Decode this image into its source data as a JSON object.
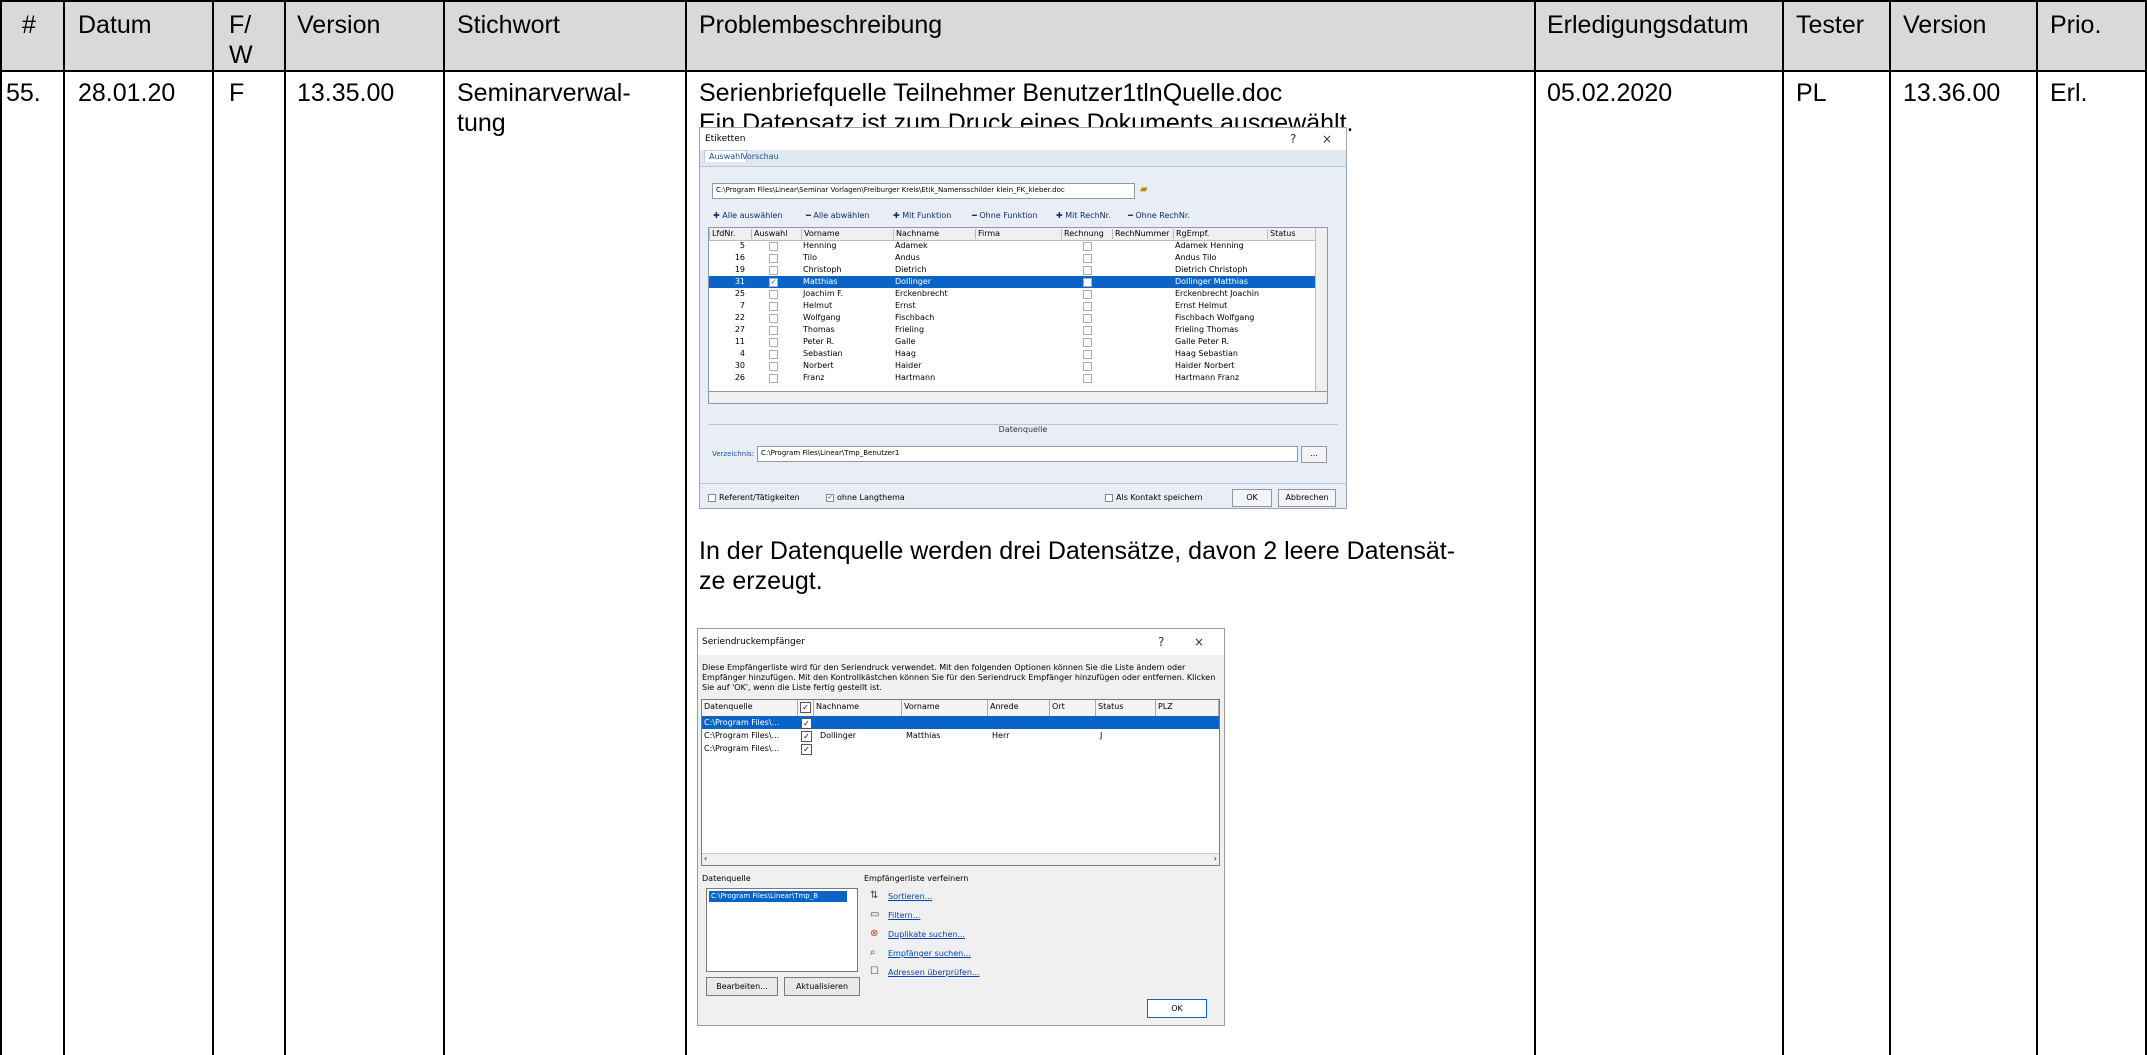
{
  "table": {
    "headers": [
      "#",
      "Datum",
      "F/\nW",
      "Version",
      "Stichwort",
      "Problembeschreibung",
      "Erledigungsdatum",
      "Tester",
      "Version",
      "Prio."
    ],
    "row": {
      "nr": "55.",
      "datum": "28.01.20",
      "fw": "F",
      "version": "13.35.00",
      "stichwort": "Seminarverwal-\ntung",
      "beschreibung_1": "Serienbriefquelle Teilnehmer Benutzer1tlnQuelle.doc\nEin Datensatz ist zum Druck eines Dokuments ausgewählt.",
      "beschreibung_2": "In der Datenquelle werden drei Datensätze, davon 2 leere Datensät-\nze erzeugt.",
      "erledigungsdatum": "05.02.2020",
      "tester": "PL",
      "version2": "13.36.00",
      "prio": "Erl."
    }
  },
  "dialog1": {
    "title": "Etiketten",
    "help": "?",
    "close": "×",
    "tabs": [
      "Auswahl",
      "Vorschau"
    ],
    "path": "C:\\Program Files\\Linear\\Seminar Vorlagen\\Freiburger Kreis\\Etik_Namensschilder klein_FK_kleber.doc",
    "actions": [
      "✚ Alle auswählen",
      "━ Alle abwählen",
      "✚ Mit Funktion",
      "━ Ohne Funktion",
      "✚ Mit RechNr.",
      "━ Ohne RechNr."
    ],
    "columns": [
      "LfdNr.",
      "Auswahl",
      "Vorname",
      "Nachname",
      "Firma",
      "Rechnung",
      "RechNummer",
      "RgEmpf.",
      "Status"
    ],
    "rows": [
      {
        "nr": "5",
        "checked": "",
        "vorname": "Henning",
        "nachname": "Adamek",
        "rgempf": "Adamek Henning"
      },
      {
        "nr": "16",
        "checked": "",
        "vorname": "Tilo",
        "nachname": "Andus",
        "rgempf": "Andus Tilo"
      },
      {
        "nr": "19",
        "checked": "",
        "vorname": "Christoph",
        "nachname": "Dietrich",
        "rgempf": "Dietrich Christoph"
      },
      {
        "nr": "31",
        "checked": "✓",
        "vorname": "Matthias",
        "nachname": "Dollinger",
        "rgempf": "Dollinger Matthias"
      },
      {
        "nr": "25",
        "checked": "",
        "vorname": "Joachim F.",
        "nachname": "Erckenbrecht",
        "rgempf": "Erckenbrecht Joachin"
      },
      {
        "nr": "7",
        "checked": "",
        "vorname": "Helmut",
        "nachname": "Ernst",
        "rgempf": "Ernst Helmut"
      },
      {
        "nr": "22",
        "checked": "",
        "vorname": "Wolfgang",
        "nachname": "Fischbach",
        "rgempf": "Fischbach Wolfgang"
      },
      {
        "nr": "27",
        "checked": "",
        "vorname": "Thomas",
        "nachname": "Frieling",
        "rgempf": "Frieling Thomas"
      },
      {
        "nr": "11",
        "checked": "",
        "vorname": "Peter R.",
        "nachname": "Galle",
        "rgempf": "Galle Peter R."
      },
      {
        "nr": "4",
        "checked": "",
        "vorname": "Sebastian",
        "nachname": "Haag",
        "rgempf": "Haag Sebastian"
      },
      {
        "nr": "30",
        "checked": "",
        "vorname": "Norbert",
        "nachname": "Haider",
        "rgempf": "Haider Norbert"
      },
      {
        "nr": "26",
        "checked": "",
        "vorname": "Franz",
        "nachname": "Hartmann",
        "rgempf": "Hartmann Franz"
      }
    ],
    "datenquelle_label": "Datenquelle",
    "verzeichnis_label": "Verzeichnis:",
    "verzeichnis_value": "C:\\Program Files\\Linear\\Tmp_Benutzer1",
    "browse_label": "...",
    "cb_referent": "Referent/Tätigkeiten",
    "cb_langthema": "ohne Langthema",
    "cb_kontakt": "Als Kontakt speichern",
    "ok_label": "OK",
    "cancel_label": "Abbrechen"
  },
  "dialog2": {
    "title": "Seriendruckempfänger",
    "help": "?",
    "close": "×",
    "intro": "Diese Empfängerliste wird für den Seriendruck verwendet. Mit den folgenden Optionen können Sie die Liste ändern oder Empfänger hinzufügen. Mit den Kontrollkästchen können Sie für den Seriendruck Empfänger hinzufügen oder entfernen. Klicken Sie auf 'OK', wenn die Liste fertig gestellt ist.",
    "columns": [
      "Datenquelle",
      "✓",
      "Nachname",
      "Vorname",
      "Anrede",
      "Ort",
      "Status",
      "PLZ"
    ],
    "rows": [
      {
        "quelle": "C:\\Program Files\\...",
        "nachname": "",
        "vorname": "",
        "anrede": "",
        "status": ""
      },
      {
        "quelle": "C:\\Program Files\\...",
        "nachname": "Dollinger",
        "vorname": "Matthias",
        "anrede": "Herr",
        "status": "J"
      },
      {
        "quelle": "C:\\Program Files\\...",
        "nachname": "",
        "vorname": "",
        "anrede": "",
        "status": ""
      }
    ],
    "datenquelle_label": "Datenquelle",
    "datenquelle_item": "C:\\Program Files\\Linear\\Tmp_B",
    "verfeinern_label": "Empfängerliste verfeinern",
    "links": [
      "Sortieren...",
      "Filtern...",
      "Duplikate suchen...",
      "Empfänger suchen...",
      "Adressen überprüfen..."
    ],
    "edit_label": "Bearbeiten...",
    "refresh_label": "Aktualisieren",
    "ok_label": "OK"
  }
}
